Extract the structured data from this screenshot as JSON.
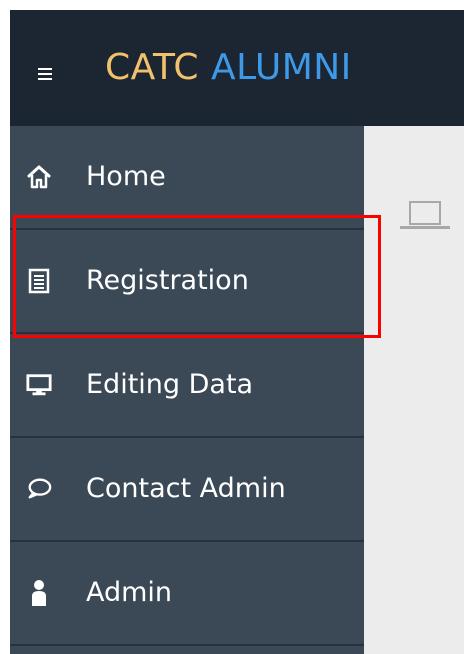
{
  "header": {
    "menu_icon": "hamburger-icon",
    "brand_part1": "CATC",
    "brand_part2": "ALUMNI",
    "brand_part1_color": "#f2c16b",
    "brand_part2_color": "#3e9ae8",
    "background": "#1c2633"
  },
  "sidebar": {
    "background": "#3b4856",
    "items": [
      {
        "label": "Home",
        "icon": "home-icon"
      },
      {
        "label": "Registration",
        "icon": "document-icon"
      },
      {
        "label": "Editing Data",
        "icon": "monitor-icon",
        "highlighted": true
      },
      {
        "label": "Contact Admin",
        "icon": "chat-bubble-icon"
      },
      {
        "label": "Admin",
        "icon": "user-icon"
      }
    ]
  },
  "main": {
    "icon": "laptop-icon",
    "background": "#ececec"
  },
  "annotation": {
    "highlight_color": "#ff0000"
  }
}
